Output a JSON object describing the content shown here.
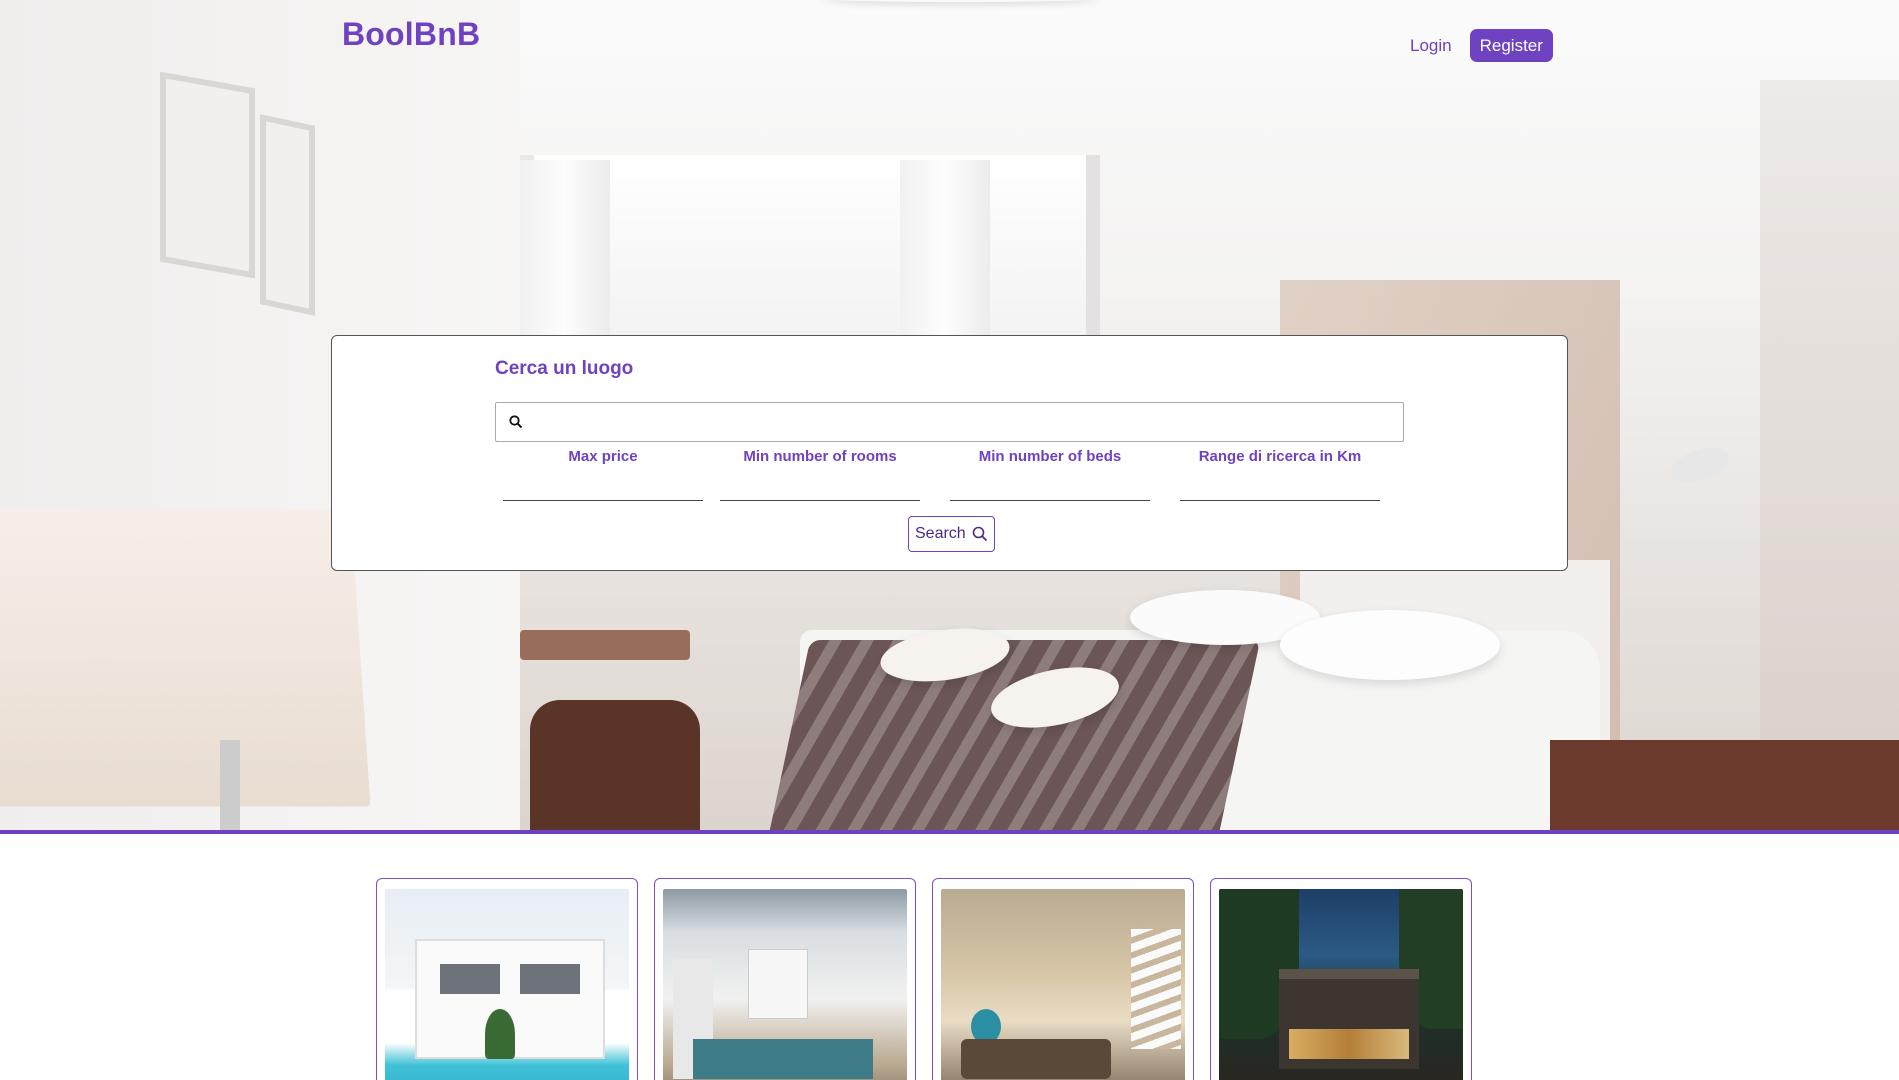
{
  "header": {
    "brand": "BoolBnB",
    "login_label": "Login",
    "register_label": "Register"
  },
  "search": {
    "title": "Cerca un luogo",
    "query_value": "",
    "query_placeholder": "",
    "filters": {
      "max_price_label": "Max price",
      "min_rooms_label": "Min number of rooms",
      "min_beds_label": "Min number of beds",
      "range_label": "Range di ricerca in Km"
    },
    "button_label": "Search"
  },
  "listings": {
    "count_visible": 4
  },
  "colors": {
    "accent": "#6f42c1",
    "text_on_accent": "#ffffff"
  },
  "icons": {
    "search_bar": "search-icon",
    "search_button": "search-icon"
  }
}
